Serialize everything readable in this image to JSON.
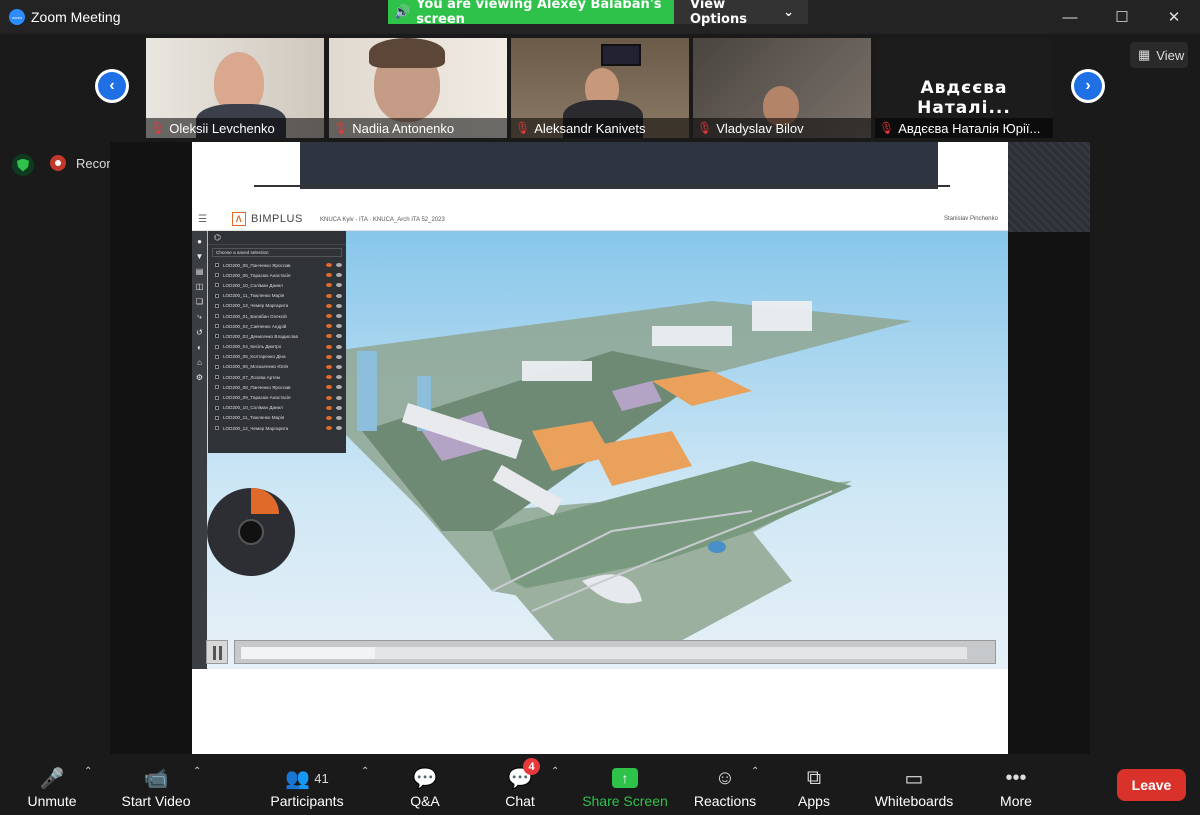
{
  "window": {
    "title": "Zoom Meeting",
    "controls": {
      "minimize": "—",
      "maximize": "☐",
      "close": "✕"
    }
  },
  "banner": {
    "viewing_text": "You are viewing Alexey Balaban's screen",
    "view_options_label": "View Options"
  },
  "view_button": {
    "label": "View"
  },
  "participants_strip": [
    {
      "name": "Oleksii Levchenko"
    },
    {
      "name": "Nadiia Antonenko"
    },
    {
      "name": "Aleksandr Kanivets"
    },
    {
      "name": "Vladyslav Bilov"
    },
    {
      "name": "Авдєєва Наталія Юрії...",
      "display_title": "Авдєєва Наталі..."
    }
  ],
  "status": {
    "recording_label": "Recording"
  },
  "shared_app": {
    "logo_text": "BIMPLUS",
    "breadcrumb": "KNUCA Kyiv · ITA  ·  KNUCA_Arch ITA 52_2023",
    "user": "Stanislav Pinchenko",
    "selection_placeholder": "Choose a saved selection",
    "layers": [
      "LOD200_06_Панченко Ярослав",
      "LOD200_06_Тарасюк Анастасія",
      "LOD200_10_Соліман Данил",
      "LOD200_11_Тюкленко Марія",
      "LOD200_12_Чемер Маргарита",
      "LOD200_01_Балабан Олексій",
      "LOD200_02_Савченко Андрій",
      "LOD200_03_Денисенко Владислав",
      "LOD200_04_Кисіль Дмитро",
      "LOD200_05_Колтаренко Діна",
      "LOD200_06_Москаленко Юлія",
      "LOD200_07_Лозова Артем",
      "LOD200_08_Панченко Ярослав",
      "LOD200_09_Тарасюк Анастасія",
      "LOD200_10_Соліман Данил",
      "LOD200_11_Тюкленко Марія",
      "LOD200_12_Чемер Маргарита"
    ]
  },
  "toolbar": {
    "unmute": "Unmute",
    "start_video": "Start Video",
    "participants": "Participants",
    "participants_count": "41",
    "qa": "Q&A",
    "chat": "Chat",
    "chat_badge": "4",
    "share_screen": "Share Screen",
    "reactions": "Reactions",
    "apps": "Apps",
    "whiteboards": "Whiteboards",
    "more": "More",
    "leave": "Leave"
  },
  "colors": {
    "accent_green": "#2ec24a",
    "leave_red": "#d9322b",
    "nav_blue": "#1f6fe5",
    "bimplus_orange": "#e06a2a"
  }
}
